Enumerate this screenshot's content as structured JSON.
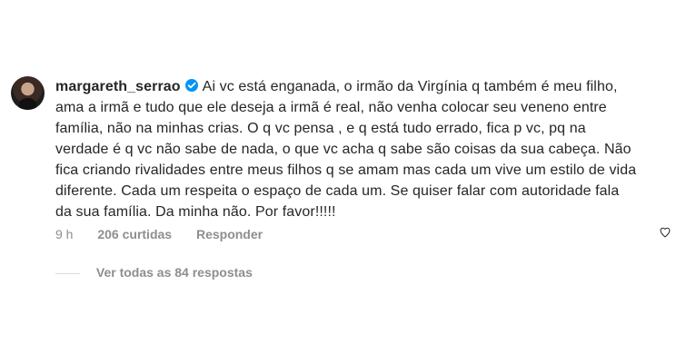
{
  "comment": {
    "username": "margareth_serrao",
    "verified": true,
    "text": "Ai vc está enganada, o irmão da Virgínia q também é meu filho, ama a irmã e tudo que ele deseja a irmã é real, não venha colocar seu veneno entre família, não na minhas crias. O q vc pensa , e q está tudo errado, fica p vc, pq na verdade é q vc não sabe de nada, o que vc acha q sabe são coisas da sua cabeça. Não fica criando rivalidades entre meus filhos q se amam mas cada um vive um estilo de vida diferente. Cada um respeita o espaço de cada um. Se quiser falar com autoridade fala da sua família. Da minha não. Por favor!!!!!",
    "time": "9 h",
    "likes": "206 curtidas",
    "reply_label": "Responder",
    "view_replies": "Ver todas as 84 respostas"
  },
  "icons": {
    "verified_badge": "verified-badge-icon",
    "like": "heart-icon"
  },
  "colors": {
    "verified_blue": "#0095f6",
    "secondary_text": "#8e8e8e",
    "primary_text": "#262626"
  }
}
